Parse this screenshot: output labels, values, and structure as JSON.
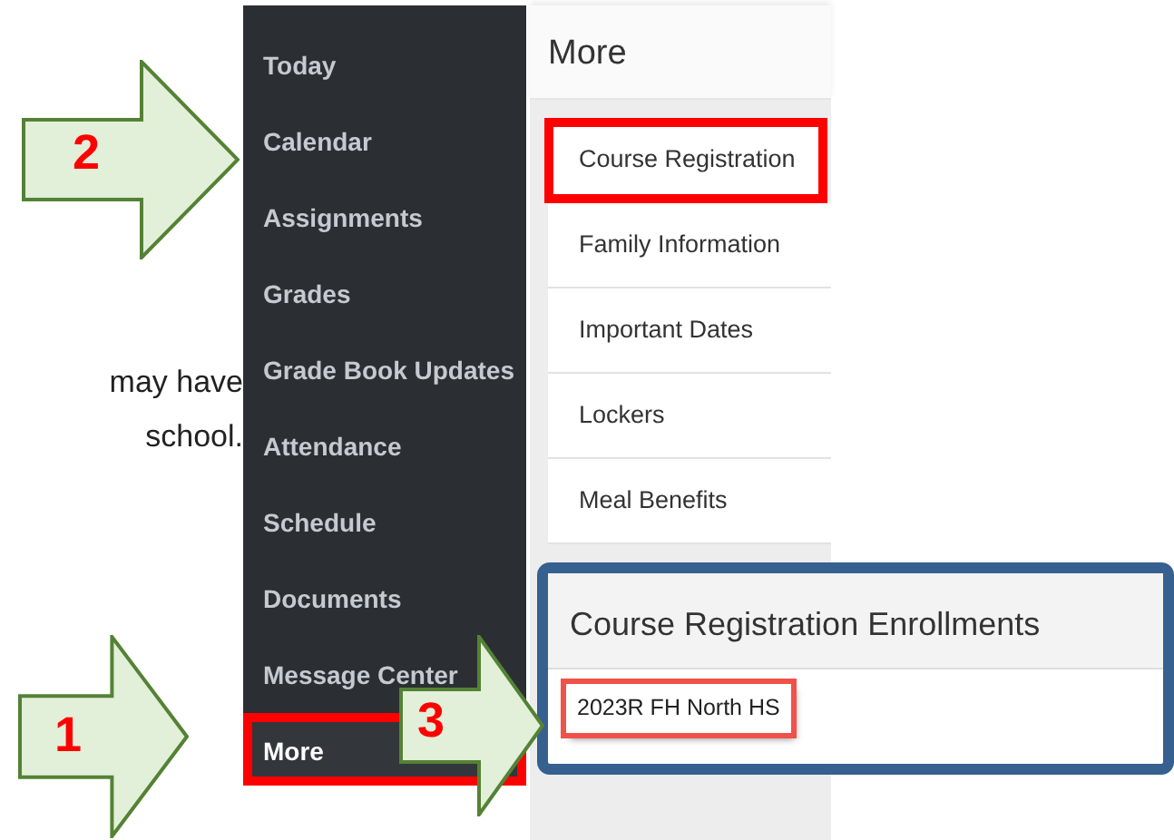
{
  "instruction_text": [
    "may have",
    "school."
  ],
  "sidebar": {
    "items": [
      {
        "label": "Today",
        "selected": false
      },
      {
        "label": "Calendar",
        "selected": false
      },
      {
        "label": "Assignments",
        "selected": false
      },
      {
        "label": "Grades",
        "selected": false
      },
      {
        "label": "Grade Book Updates",
        "selected": false
      },
      {
        "label": "Attendance",
        "selected": false
      },
      {
        "label": "Schedule",
        "selected": false
      },
      {
        "label": "Documents",
        "selected": false
      },
      {
        "label": "Message Center",
        "selected": false
      },
      {
        "label": "More",
        "selected": true,
        "highlighted": true
      }
    ]
  },
  "main": {
    "title": "More",
    "items": [
      {
        "label": "Course Registration",
        "highlighted": true
      },
      {
        "label": "Family Information",
        "highlighted": false
      },
      {
        "label": "Important Dates",
        "highlighted": false
      },
      {
        "label": "Lockers",
        "highlighted": false
      },
      {
        "label": "Meal Benefits",
        "highlighted": false
      }
    ]
  },
  "popup": {
    "title": "Course Registration Enrollments",
    "rows": [
      {
        "label": "2023R FH North HS",
        "highlighted": true
      }
    ]
  },
  "callouts": [
    {
      "number": "2"
    },
    {
      "number": "1"
    },
    {
      "number": "3"
    }
  ]
}
